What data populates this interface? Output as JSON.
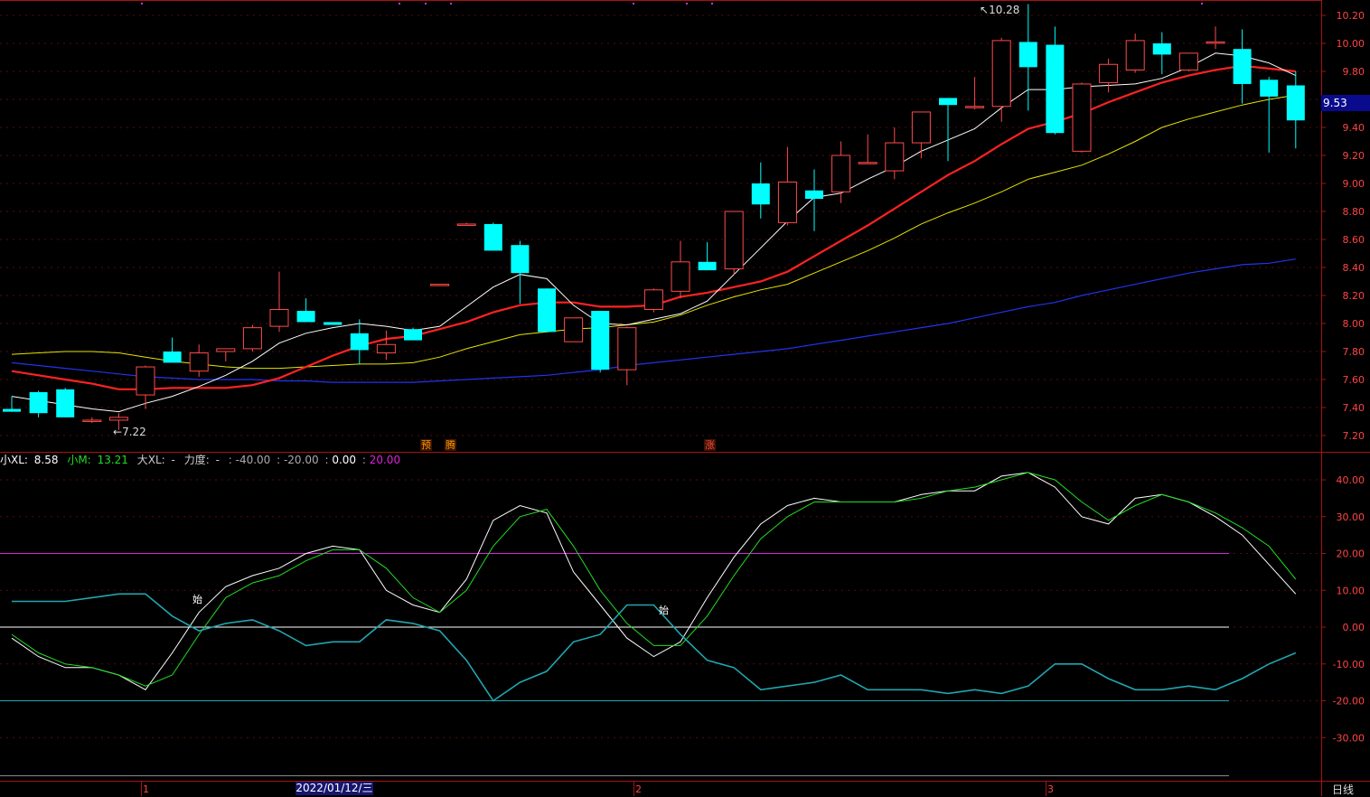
{
  "colors": {
    "up": "#ff4a4a",
    "down": "#00ffff",
    "ma5": "#ffffff",
    "ma10": "#ff2222",
    "ma20": "#e6e600",
    "ma60": "#2233ee",
    "axis": "#aa1111",
    "small_xl": "#ffffff",
    "small_m": "#22dd22",
    "power": "#21a5b0",
    "line20": "#dd22dd"
  },
  "price_axis": {
    "ticks": [
      "10.20",
      "10.00",
      "9.80",
      "9.60",
      "9.40",
      "9.20",
      "9.00",
      "8.80",
      "8.60",
      "8.40",
      "8.20",
      "8.00",
      "7.80",
      "7.60",
      "7.40",
      "7.20"
    ],
    "current": "9.53"
  },
  "annotations": {
    "high": "10.28",
    "low": "7.22"
  },
  "badges": [
    {
      "id": "yu",
      "text": "预",
      "color": "#ff9900"
    },
    {
      "id": "teng",
      "text": "腾",
      "color": "#ff9900"
    },
    {
      "id": "zhang",
      "text": "涨",
      "color": "#ff4444"
    }
  ],
  "indicator": {
    "name_xl": "小XL:",
    "xl_value": "8.58",
    "name_m": "小M:",
    "m_value": "13.21",
    "name_big": "大XL:",
    "big_value": "-",
    "name_power": "力度:",
    "power_value": "-",
    "lv1": "-40.00",
    "lv2": "-20.00",
    "lv3": "0.00",
    "lv4": "20.00",
    "signals": [
      "始",
      "始"
    ],
    "axis_ticks": [
      "40.00",
      "30.00",
      "20.00",
      "10.00",
      "0.00",
      "-10.00",
      "-20.00",
      "-30.00"
    ]
  },
  "time_axis": {
    "marks": [
      "1",
      "2",
      "3"
    ],
    "cursor_date": "2022/01/12/三",
    "period": "日线"
  },
  "chart_data": [
    {
      "type": "candlestick",
      "title": "",
      "ylim": [
        7.12,
        10.28
      ],
      "ohlc": [
        [
          7.39,
          7.48,
          7.37,
          7.37
        ],
        [
          7.51,
          7.52,
          7.33,
          7.36
        ],
        [
          7.53,
          7.54,
          7.33,
          7.33
        ],
        [
          7.31,
          7.33,
          7.29,
          7.31
        ],
        [
          7.31,
          7.36,
          7.24,
          7.33
        ],
        [
          7.49,
          7.7,
          7.39,
          7.69
        ],
        [
          7.8,
          7.9,
          7.76,
          7.72
        ],
        [
          7.66,
          7.85,
          7.62,
          7.79
        ],
        [
          7.8,
          7.82,
          7.73,
          7.82
        ],
        [
          7.82,
          7.99,
          7.8,
          7.97
        ],
        [
          7.98,
          8.37,
          7.94,
          8.1
        ],
        [
          8.09,
          8.18,
          8.01,
          8.01
        ],
        [
          8.01,
          8.01,
          7.99,
          7.99
        ],
        [
          7.93,
          8.03,
          7.71,
          7.81
        ],
        [
          7.79,
          7.95,
          7.74,
          7.85
        ],
        [
          7.96,
          7.97,
          7.88,
          7.88
        ],
        [
          8.28,
          8.28,
          8.28,
          8.28
        ],
        [
          8.71,
          8.72,
          8.71,
          8.71
        ],
        [
          8.71,
          8.72,
          8.52,
          8.52
        ],
        [
          8.56,
          8.59,
          8.14,
          8.36
        ],
        [
          8.25,
          8.25,
          7.94,
          7.94
        ],
        [
          7.87,
          8.04,
          7.88,
          8.04
        ],
        [
          8.09,
          8.09,
          7.65,
          7.67
        ],
        [
          7.67,
          7.98,
          7.56,
          7.97
        ],
        [
          8.1,
          8.25,
          8.08,
          8.24
        ],
        [
          8.23,
          8.59,
          8.18,
          8.44
        ],
        [
          8.44,
          8.58,
          8.38,
          8.38
        ],
        [
          8.39,
          8.8,
          8.35,
          8.8
        ],
        [
          9.0,
          9.15,
          8.75,
          8.85
        ],
        [
          8.72,
          9.26,
          8.7,
          9.01
        ],
        [
          8.95,
          9.1,
          8.66,
          8.89
        ],
        [
          8.94,
          9.3,
          8.86,
          9.2
        ],
        [
          9.15,
          9.35,
          9.14,
          9.15
        ],
        [
          9.09,
          9.4,
          9.03,
          9.29
        ],
        [
          9.29,
          9.51,
          9.18,
          9.51
        ],
        [
          9.61,
          9.61,
          9.16,
          9.56
        ],
        [
          9.55,
          9.76,
          9.53,
          9.55
        ],
        [
          9.55,
          10.04,
          9.44,
          10.02
        ],
        [
          10.01,
          10.28,
          9.52,
          9.83
        ],
        [
          9.99,
          10.12,
          9.35,
          9.36
        ],
        [
          9.23,
          9.72,
          9.22,
          9.71
        ],
        [
          9.72,
          9.89,
          9.65,
          9.85
        ],
        [
          9.81,
          10.07,
          9.79,
          10.02
        ],
        [
          10.0,
          10.08,
          9.78,
          9.92
        ],
        [
          9.81,
          9.93,
          9.8,
          9.93
        ],
        [
          10.01,
          10.12,
          9.96,
          10.01
        ],
        [
          9.96,
          10.1,
          9.57,
          9.71
        ],
        [
          9.74,
          9.76,
          9.22,
          9.62
        ],
        [
          9.7,
          9.8,
          9.25,
          9.45
        ]
      ],
      "ma5": [
        7.48,
        7.45,
        7.42,
        7.39,
        7.37,
        7.43,
        7.48,
        7.55,
        7.63,
        7.73,
        7.86,
        7.93,
        7.97,
        8.0,
        7.98,
        7.95,
        7.98,
        8.12,
        8.26,
        8.35,
        8.32,
        8.13,
        8.0,
        7.99,
        8.03,
        8.07,
        8.16,
        8.35,
        8.54,
        8.73,
        8.9,
        8.93,
        9.03,
        9.12,
        9.23,
        9.31,
        9.39,
        9.54,
        9.67,
        9.67,
        9.69,
        9.7,
        9.71,
        9.75,
        9.83,
        9.93,
        9.91,
        9.86,
        9.77
      ],
      "ma10": [
        7.66,
        7.63,
        7.6,
        7.57,
        7.53,
        7.53,
        7.54,
        7.54,
        7.54,
        7.56,
        7.61,
        7.69,
        7.77,
        7.84,
        7.89,
        7.91,
        7.96,
        8.01,
        8.08,
        8.13,
        8.15,
        8.15,
        8.12,
        8.12,
        8.13,
        8.19,
        8.22,
        8.26,
        8.3,
        8.37,
        8.48,
        8.59,
        8.7,
        8.82,
        8.94,
        9.06,
        9.16,
        9.28,
        9.39,
        9.44,
        9.5,
        9.58,
        9.65,
        9.72,
        9.77,
        9.81,
        9.84,
        9.82,
        9.8
      ],
      "ma20": [
        7.78,
        7.79,
        7.8,
        7.8,
        7.79,
        7.76,
        7.73,
        7.71,
        7.69,
        7.68,
        7.68,
        7.69,
        7.7,
        7.71,
        7.71,
        7.72,
        7.76,
        7.82,
        7.87,
        7.92,
        7.94,
        7.96,
        7.97,
        7.99,
        8.01,
        8.06,
        8.13,
        8.19,
        8.24,
        8.28,
        8.36,
        8.44,
        8.52,
        8.61,
        8.71,
        8.79,
        8.86,
        8.94,
        9.03,
        9.08,
        9.13,
        9.21,
        9.3,
        9.4,
        9.46,
        9.51,
        9.56,
        9.6,
        9.63
      ],
      "ma60": [
        7.72,
        7.7,
        7.68,
        7.66,
        7.64,
        7.62,
        7.61,
        7.6,
        7.6,
        7.6,
        7.59,
        7.59,
        7.58,
        7.58,
        7.58,
        7.58,
        7.59,
        7.6,
        7.61,
        7.62,
        7.63,
        7.65,
        7.67,
        7.7,
        7.72,
        7.74,
        7.76,
        7.78,
        7.8,
        7.82,
        7.85,
        7.88,
        7.91,
        7.94,
        7.97,
        8.0,
        8.04,
        8.08,
        8.12,
        8.15,
        8.2,
        8.24,
        8.28,
        8.32,
        8.36,
        8.39,
        8.42,
        8.43,
        8.46
      ]
    },
    {
      "type": "line",
      "title": "",
      "ylim": [
        -40,
        45
      ],
      "series": [
        {
          "name": "小XL",
          "values": [
            -3,
            -8,
            -11,
            -11,
            -13,
            -17,
            -7,
            4,
            11,
            14,
            16,
            20,
            22,
            21,
            10,
            6,
            4,
            13,
            29,
            33,
            31,
            15,
            6,
            -3,
            -8,
            -4,
            8,
            19,
            28,
            33,
            35,
            34,
            34,
            34,
            36,
            37,
            37,
            41,
            42,
            38,
            30,
            28,
            35,
            36,
            34,
            30,
            25,
            17,
            9
          ]
        },
        {
          "name": "小M",
          "values": [
            -2,
            -7,
            -10,
            -11,
            -13,
            -16,
            -13,
            -2,
            8,
            12,
            14,
            18,
            21,
            21,
            16,
            8,
            4,
            10,
            22,
            30,
            32,
            22,
            10,
            1,
            -5,
            -5,
            3,
            14,
            24,
            30,
            34,
            34,
            34,
            34,
            35,
            37,
            38,
            40,
            42,
            40,
            34,
            29,
            33,
            36,
            34,
            31,
            27,
            22,
            13
          ]
        },
        {
          "name": "力度",
          "values": [
            7,
            7,
            7,
            8,
            9,
            9,
            3,
            -1,
            1,
            2,
            -1,
            -5,
            -4,
            -4,
            2,
            1,
            -1,
            -9,
            -20,
            -15,
            -12,
            -4,
            -2,
            6,
            6,
            -2,
            -9,
            -11,
            -17,
            -16,
            -15,
            -13,
            -17,
            -17,
            -17,
            -18,
            -17,
            -18,
            -16,
            -10,
            -10,
            -14,
            -17,
            -17,
            -16,
            -17,
            -14,
            -10,
            -7
          ]
        }
      ],
      "levels": [
        20,
        0,
        -20
      ]
    }
  ]
}
